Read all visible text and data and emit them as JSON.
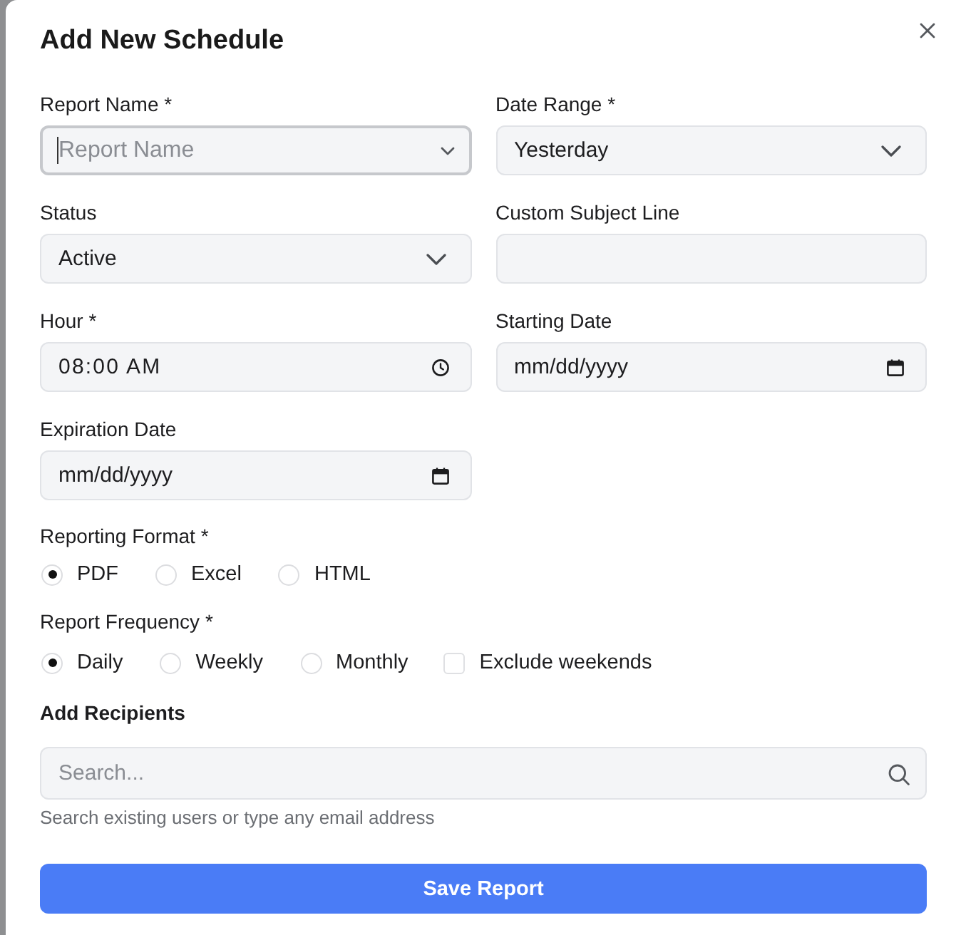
{
  "dialog": {
    "title": "Add New Schedule"
  },
  "fields": [
    {
      "kind": "combobox",
      "label": "Report Name *",
      "placeholder": "Report Name",
      "focused": true
    },
    {
      "kind": "select",
      "label": "Date Range *",
      "value": "Yesterday",
      "focused": false
    },
    {
      "kind": "select",
      "label": "Status",
      "value": "Active",
      "focused": false
    },
    {
      "kind": "text",
      "label": "Custom Subject Line",
      "focused": false
    },
    {
      "kind": "time",
      "label": "Hour *",
      "value": "08:00 AM",
      "focused": false
    },
    {
      "kind": "date",
      "label": "Starting Date",
      "placeholder": "mm/dd/yyyy",
      "focused": false
    },
    {
      "kind": "date",
      "label": "Expiration Date",
      "placeholder": "mm/dd/yyyy",
      "focused": false
    }
  ],
  "reporting_format": {
    "label": "Reporting Format *",
    "options": [
      {
        "label": "PDF",
        "selected": true
      },
      {
        "label": "Excel",
        "selected": false
      },
      {
        "label": "HTML",
        "selected": false
      }
    ]
  },
  "report_frequency": {
    "label": "Report Frequency *",
    "options": [
      {
        "kind": "radio",
        "label": "Daily",
        "selected": true
      },
      {
        "kind": "radio",
        "label": "Weekly",
        "selected": false
      },
      {
        "kind": "radio",
        "label": "Monthly",
        "selected": false
      },
      {
        "kind": "checkbox",
        "label": "Exclude weekends",
        "checked": false
      }
    ]
  },
  "recipients": {
    "label": "Add Recipients",
    "search": {
      "placeholder": "Search..."
    },
    "hint": "Search existing users or type any email address"
  },
  "save_button": {
    "label": "Save Report"
  }
}
